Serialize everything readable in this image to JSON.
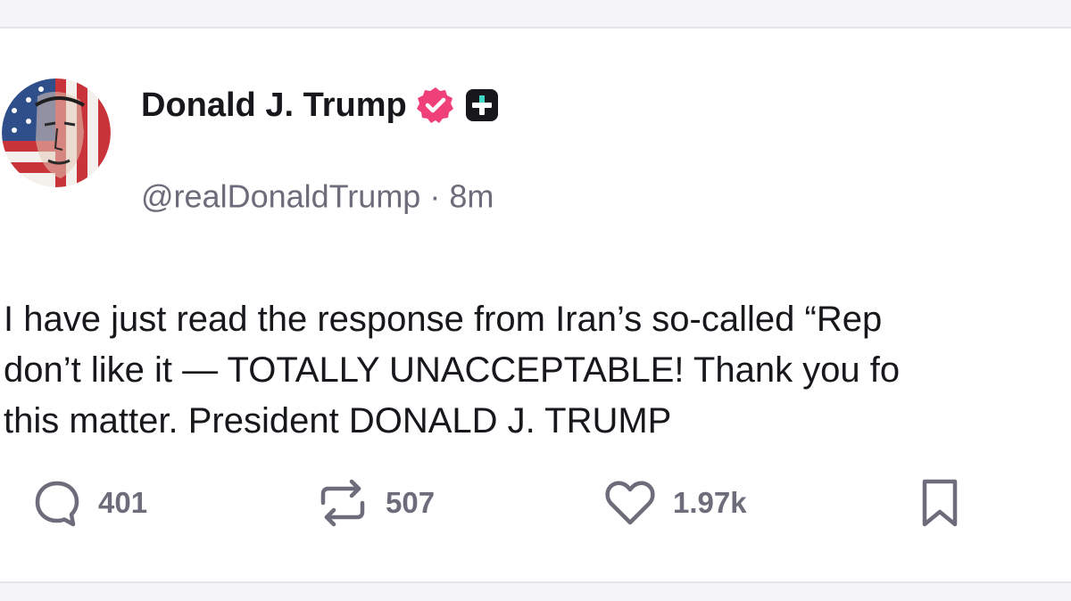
{
  "post": {
    "author": {
      "display_name": "Donald J. Trump",
      "handle": "@realDonaldTrump",
      "separator": "·",
      "time_ago": "8m",
      "verified_icon": "verified-badge-icon",
      "subscriber_icon": "plus-badge-icon"
    },
    "body_lines": [
      "I have just read the response from Iran’s so-called “Rep",
      "don’t like it — TOTALLY UNACCEPTABLE! Thank you fo",
      "this matter. President DONALD J. TRUMP"
    ],
    "actions": {
      "replies": "401",
      "reposts": "507",
      "likes": "1.97k"
    }
  },
  "colors": {
    "verified_badge": "#f0407a",
    "muted_text": "#6c6c7a",
    "primary_text": "#17171c"
  }
}
